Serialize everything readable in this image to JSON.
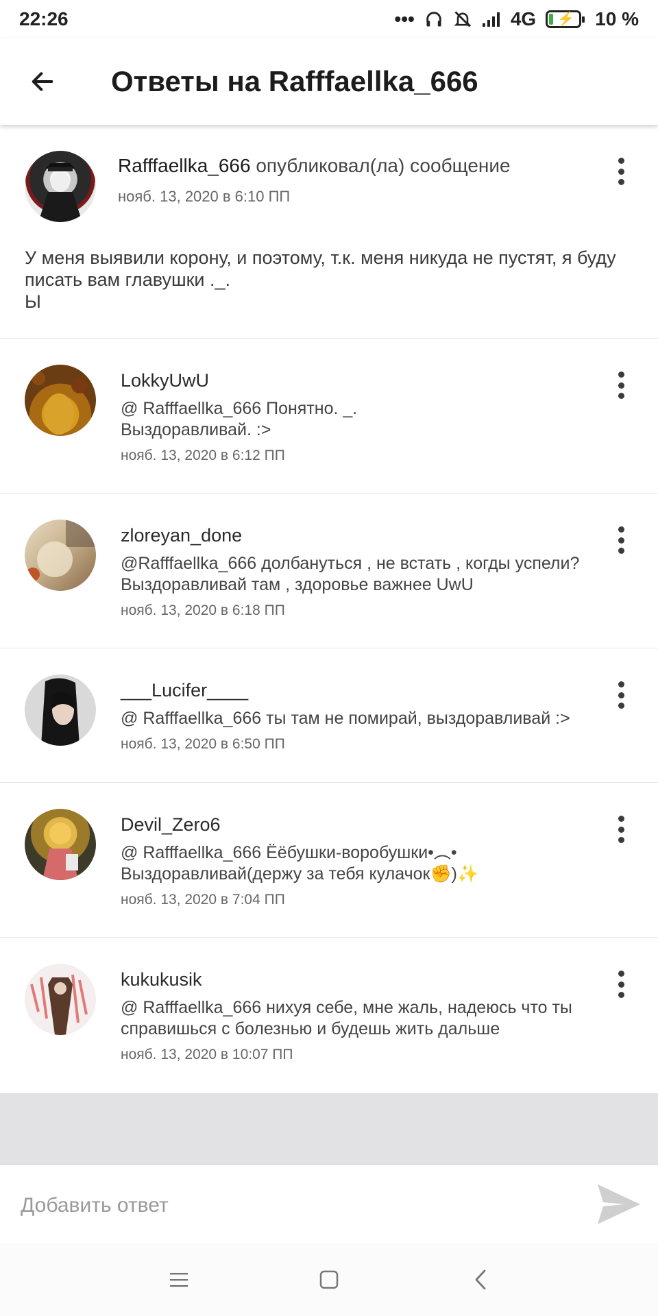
{
  "status_bar": {
    "time": "22:26",
    "network": "4G",
    "battery": "10 %"
  },
  "header": {
    "title": "Ответы на Rafffaellka_666"
  },
  "post": {
    "author": "Rafffaellka_666",
    "verb": "опубликовал(ла) сообщение",
    "time": "нояб. 13, 2020 в 6:10 ПП",
    "body": "У меня выявили корону, и поэтому, т.к. меня никуда не пустят, я буду писать вам главушки ._.\nЫ"
  },
  "replies": [
    {
      "author": "LokkyUwU",
      "text": "@ Rafffaellka_666  Понятно. _.\nВыздоравливай. :>",
      "time": "нояб. 13, 2020 в 6:12 ПП"
    },
    {
      "author": "zloreyan_done",
      "text": "@Rafffaellka_666  долбануться , не встать , когды успели?\nВыздоравливай там , здоровье важнее UwU",
      "time": "нояб. 13, 2020 в 6:18 ПП"
    },
    {
      "author": "___Lucifer____",
      "text": "@ Rafffaellka_666  ты там не помирай, выздоравливай :>",
      "time": "нояб. 13, 2020 в 6:50 ПП"
    },
    {
      "author": "Devil_Zero6",
      "text": "@ Rafffaellka_666   Ёёбушки-воробушки•︵•\nВыздоравливай(держу за тебя кулачок✊)✨",
      "time": "нояб. 13, 2020 в 7:04 ПП"
    },
    {
      "author": "kukukusik",
      "text": "@ Rafffaellka_666  нихуя себе, мне жаль, надеюсь что ты справишься с болезнью и будешь жить дальше",
      "time": "нояб. 13, 2020 в 10:07 ПП"
    }
  ],
  "composer": {
    "placeholder": "Добавить ответ"
  },
  "icons": {
    "back": "arrow-left-icon",
    "more": "more-vertical-icon",
    "send": "send-icon",
    "nav": [
      "menu-icon",
      "home-square-icon",
      "back-chevron-icon"
    ]
  },
  "colors": {
    "band": "#e2e2e5",
    "send_icon": "#cfcfcf"
  }
}
